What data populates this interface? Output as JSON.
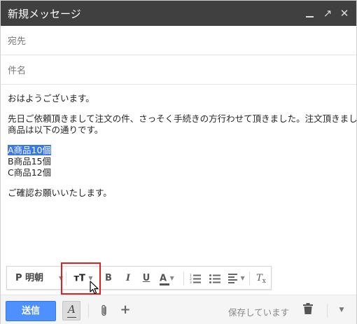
{
  "window": {
    "title": "新規メッセージ",
    "close_glyph": "✕",
    "popout_glyph": "↗"
  },
  "fields": {
    "to_placeholder": "宛先",
    "subject_placeholder": "件名"
  },
  "message": {
    "greeting": "おはようございます。",
    "line1": "先日ご依頼頂きまして注文の件、さっそく手続きの方行わせて頂きました。注文頂きました",
    "line2": "商品は以下の通りです。",
    "items": [
      "A商品10個",
      "B商品15個",
      "C商品12個"
    ],
    "selected_item_index": 0,
    "closing": "ご確認お願いいたします。"
  },
  "format_toolbar": {
    "font": "P 明朝",
    "size_icon": "тT",
    "bold": "B",
    "italic": "I",
    "underline": "U",
    "text_color": "A",
    "clear_format": "T",
    "caret": "▼"
  },
  "bottom_bar": {
    "send_label": "送信",
    "format_toggle": "A",
    "attach_glyph": "📎",
    "plus_glyph": "+",
    "status": "保存しています",
    "more_glyph": "▼"
  },
  "colors": {
    "titlebar": "#404040",
    "send_button": "#4d90fe",
    "selection": "#3b78e7",
    "highlight_box": "#e02020"
  },
  "icons": [
    "minimize-icon",
    "popout-icon",
    "close-icon",
    "text-size-icon",
    "numbered-list-icon",
    "bulleted-list-icon",
    "align-icon",
    "remove-formatting-icon",
    "attach-icon",
    "plus-icon",
    "trash-icon",
    "mouse-cursor-icon"
  ]
}
